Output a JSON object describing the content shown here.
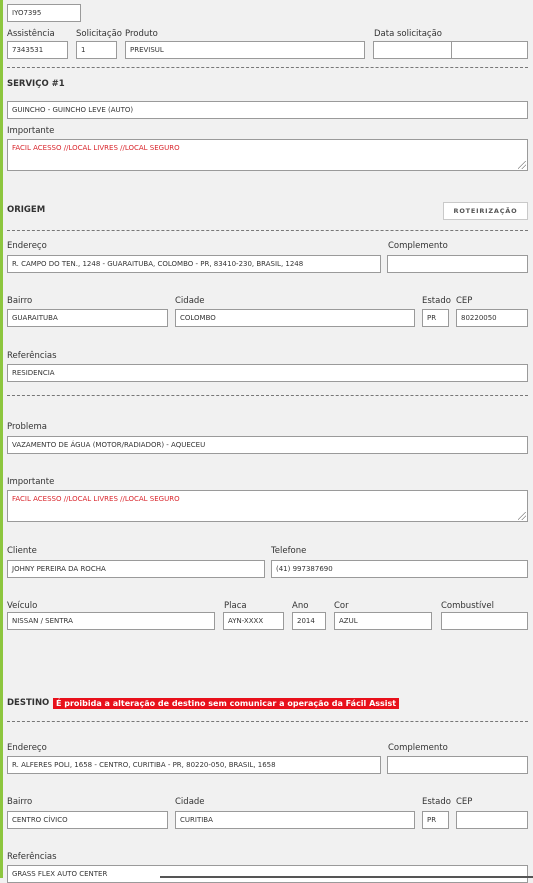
{
  "header": {
    "code_value": "IYO7395",
    "assistencia_label": "Assistência",
    "assistencia_value": "7343531",
    "solicitacao_label": "Solicitação",
    "solicitacao_value": "1",
    "produto_label": "Produto",
    "produto_value": "PREVISUL",
    "data_solicitacao_label": "Data solicitação",
    "data_value": "",
    "hora_value": ""
  },
  "servico": {
    "title": "SERVIÇO #1",
    "tipo_value": "GUINCHO - GUINCHO LEVE (AUTO)",
    "importante_label": "Importante",
    "importante_value": "FACIL ACESSO //LOCAL LIVRES //LOCAL SEGURO"
  },
  "origem": {
    "title": "ORIGEM",
    "roteirizacao_label": "ROTEIRIZAÇÃO",
    "endereco_label": "Endereço",
    "endereco_value": "R. CAMPO DO TEN., 1248 - GUARAITUBA, COLOMBO - PR, 83410-230, BRASIL, 1248",
    "complemento_label": "Complemento",
    "complemento_value": "",
    "bairro_label": "Bairro",
    "bairro_value": "GUARAITUBA",
    "cidade_label": "Cidade",
    "cidade_value": "COLOMBO",
    "estado_label": "Estado",
    "estado_value": "PR",
    "cep_label": "CEP",
    "cep_value": "80220050",
    "referencias_label": "Referências",
    "referencias_value": "RESIDENCIA"
  },
  "ocorrencia": {
    "problema_label": "Problema",
    "problema_value": "VAZAMENTO DE ÁGUA (MOTOR/RADIADOR) - AQUECEU",
    "importante_label": "Importante",
    "importante_value": "FACIL ACESSO //LOCAL LIVRES //LOCAL SEGURO",
    "cliente_label": "Cliente",
    "cliente_value": "JOHNY PEREIRA DA ROCHA",
    "telefone_label": "Telefone",
    "telefone_value": "(41) 997387690",
    "veiculo_label": "Veículo",
    "veiculo_value": "NISSAN / SENTRA",
    "placa_label": "Placa",
    "placa_value": "AYN-XXXX",
    "ano_label": "Ano",
    "ano_value": "2014",
    "cor_label": "Cor",
    "cor_value": "AZUL",
    "combustivel_label": "Combustível",
    "combustivel_value": ""
  },
  "destino": {
    "title": "DESTINO",
    "warning": "É proibida a alteração de destino sem comunicar a operação da Fácil Assist",
    "endereco_label": "Endereço",
    "endereco_value": "R. ALFERES POLI, 1658 - CENTRO, CURITIBA - PR, 80220-050, BRASIL, 1658",
    "complemento_label": "Complemento",
    "complemento_value": "",
    "bairro_label": "Bairro",
    "bairro_value": "CENTRO CÍVICO",
    "cidade_label": "Cidade",
    "cidade_value": "CURITIBA",
    "estado_label": "Estado",
    "estado_value": "PR",
    "cep_label": "CEP",
    "cep_value": "",
    "referencias_label": "Referências",
    "referencias_value": "GRASS FLEX AUTO CENTER"
  },
  "colors": {
    "accent": "#8dc63f",
    "warning_bg": "#e8101b",
    "important_text": "#d9262d"
  }
}
